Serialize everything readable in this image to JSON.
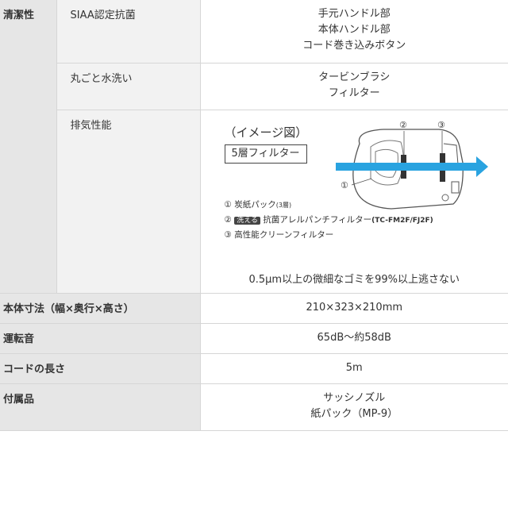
{
  "rows": {
    "seiketsu": {
      "category": "清潔性",
      "items": [
        {
          "label": "SIAA認定抗菌",
          "values": [
            "手元ハンドル部",
            "本体ハンドル部",
            "コード巻き込みボタン"
          ]
        },
        {
          "label": "丸ごと水洗い",
          "values": [
            "タービンブラシ",
            "フィルター"
          ]
        },
        {
          "label": "排気性能"
        }
      ]
    },
    "exhaust": {
      "title": "（イメージ図）",
      "box_label": "5層フィルター",
      "callouts": [
        "①",
        "②",
        "③"
      ],
      "legend": {
        "l1_marker": "①",
        "l1_text": "炭紙パック",
        "l1_note": "(3層)",
        "l2_marker": "②",
        "l2_badge": "洗える",
        "l2_text": "抗菌アレルパンチフィルター",
        "l2_model": "(TC-FM2F/FJ2F)",
        "l3_marker": "③",
        "l3_text": "高性能クリーンフィルター"
      },
      "note": "0.5μm以上の微細なゴミを99%以上逃さない",
      "arrow_color": "#29a3e0"
    },
    "size": {
      "label": "本体寸法（幅×奥行×高さ）",
      "value": "210×323×210mm"
    },
    "noise": {
      "label": "運転音",
      "value": "65dB～約58dB"
    },
    "cord": {
      "label": "コードの長さ",
      "value": "5m"
    },
    "accessories": {
      "label": "付属品",
      "values": [
        "サッシノズル",
        "紙パック（MP-9）"
      ]
    }
  }
}
